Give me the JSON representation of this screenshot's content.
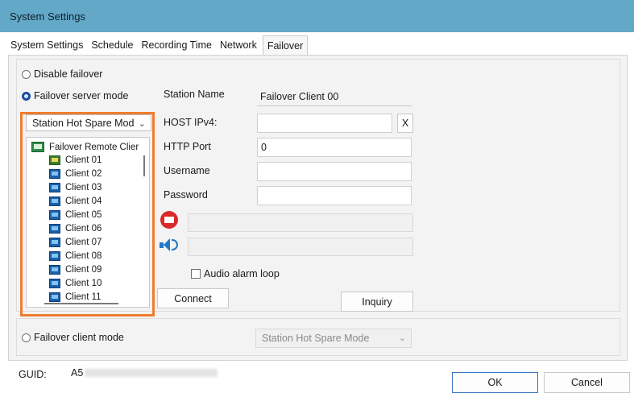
{
  "window": {
    "title": "System Settings"
  },
  "tabs": [
    "System Settings",
    "Schedule",
    "Recording Time",
    "Network",
    "Failover"
  ],
  "active_tab": "Failover",
  "failover": {
    "disable_label": "Disable failover",
    "server_mode_label": "Failover server mode",
    "client_mode_label": "Failover client mode",
    "selected_mode": "server",
    "server_mode_select": "Station Hot Spare Mod",
    "client_mode_select": "Station Hot Spare Mode"
  },
  "tree": {
    "root": "Failover Remote Clier",
    "clients": [
      "Client 01",
      "Client 02",
      "Client 03",
      "Client 04",
      "Client 05",
      "Client 06",
      "Client 07",
      "Client 08",
      "Client 09",
      "Client 10",
      "Client 11"
    ]
  },
  "form": {
    "station_name_label": "Station Name",
    "station_name_value": "Failover Client 00",
    "host_label": "HOST IPv4:",
    "host_value": "",
    "clear_button": "X",
    "http_port_label": "HTTP Port",
    "http_port_value": "0",
    "username_label": "Username",
    "username_value": "",
    "password_label": "Password",
    "password_value": "",
    "audio_alarm_label": "Audio alarm loop",
    "audio_alarm_checked": false
  },
  "buttons": {
    "connect": "Connect",
    "inquiry": "Inquiry",
    "ok": "OK",
    "cancel": "Cancel"
  },
  "guid": {
    "label": "GUID:",
    "value_visible": "A5"
  },
  "colors": {
    "titlebar": "#63a9c7",
    "highlight_border": "#ef7d2d",
    "radio_selected": "#1a4ea0"
  },
  "icons": {
    "email": "email-alert-icon",
    "audio": "speaker-icon"
  }
}
